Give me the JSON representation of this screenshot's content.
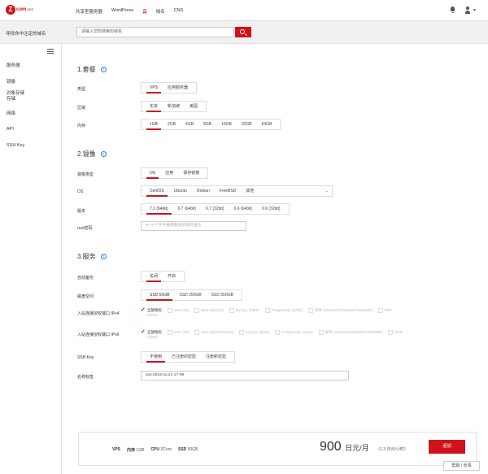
{
  "brand": {
    "logo_letter": "Z",
    "logo_text": "com",
    "logo_small": ".ORG"
  },
  "nav": {
    "items": [
      "共享型服务器",
      "WordPress",
      "云",
      "域名",
      "CNS"
    ]
  },
  "search": {
    "label": "寻找命中注定的域名",
    "placeholder": "请输入您想搜索的域名"
  },
  "sidebar": {
    "items": [
      "服务器",
      "镜像",
      "对象存储",
      "存储",
      "网络",
      "API",
      "SSH Key"
    ]
  },
  "section1": {
    "title": "1.套餐",
    "type_label": "类型",
    "type_options": [
      "VPS",
      "应用服务器"
    ],
    "region_label": "区域",
    "region_options": [
      "东京",
      "新加坡",
      "美国"
    ],
    "mem_label": "内存",
    "mem_options": [
      "1GB",
      "2GB",
      "4GB",
      "8GB",
      "16GB",
      "32GB",
      "64GB"
    ]
  },
  "section2": {
    "title": "2.镜像",
    "imgtype_label": "镜像类型",
    "imgtype_options": [
      "OS",
      "应用",
      "保存镜像"
    ],
    "os_label": "OS",
    "os_options": [
      "CentOS",
      "Ubuntu",
      "Debian",
      "FreeBSD",
      "其他"
    ],
    "version_label": "版本",
    "version_options": [
      "7.1 (64bit)",
      "6.7 (64bit)",
      "6.7 (32bit)",
      "6.6 (64bit)",
      "6.6 (32bit)"
    ],
    "root_label": "root密码",
    "root_placeholder": "9~70个字半角英数及符号的组合"
  },
  "section3": {
    "title": "3.服务",
    "backup_label": "自动备份",
    "backup_options": [
      "关闭",
      "开启"
    ],
    "disk_label": "磁盘空间",
    "disk_options": [
      "SSD 50GB",
      "SSD 250GB",
      "SSD 550GB"
    ],
    "ipv4_label": "入站连接授权端口 IPv4",
    "ipv6_label": "入站连接授权端口 IPv6",
    "ports_all": "全部授权",
    "ports": [
      {
        "name": "SSH (22)",
        "sub": ""
      },
      {
        "name": "Web (80/443)",
        "sub": ""
      },
      {
        "name": "Web (20/21/80/443)",
        "sub": ""
      },
      {
        "name": "MySQL (3306)",
        "sub": ""
      },
      {
        "name": "PostgreSQL (5432)",
        "sub": ""
      },
      {
        "name": "邮件 (25/110/143/465/587/993/995)",
        "sub": ""
      },
      {
        "name": "RDP",
        "sub": ""
      }
    ],
    "ipv4_sub": "(3389)",
    "ipv6_sub": "(3389)",
    "sshkey_label": "SSH Key",
    "sshkey_options": [
      "不使用",
      "已注册的密匙",
      "注册新密匙"
    ],
    "name_label": "名称标签",
    "name_value": "vps-2018-11-21-17-09"
  },
  "summary": {
    "vps": "VPS",
    "mem_label": "内存",
    "mem_value": "1GB",
    "cpu_label": "CPU",
    "cpu_value": "2Core",
    "ssd_label": "SSD",
    "ssd_value": "50GB",
    "price": "900",
    "price_unit": "日元/月",
    "per_hour": "（1.3 日元/小时）",
    "add_button": "追加"
  },
  "feedback": "帮助 / 反馈"
}
